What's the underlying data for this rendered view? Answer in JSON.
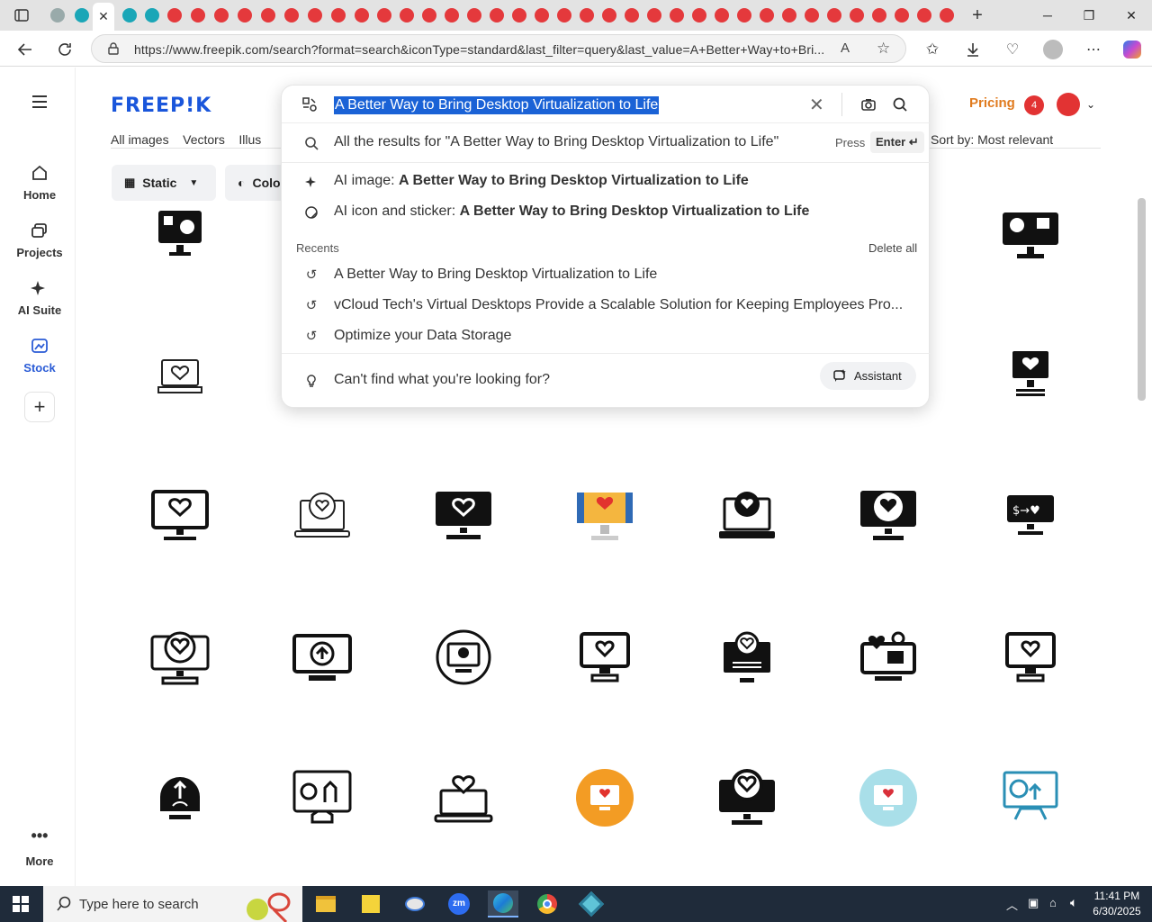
{
  "browser": {
    "url": "https://www.freepik.com/search?format=search&iconType=standard&last_filter=query&last_value=A+Better+Way+to+Bri...",
    "window_controls": [
      "minimize",
      "restore",
      "close"
    ]
  },
  "page": {
    "logo": "FREEP!K",
    "nav": {
      "items": [
        {
          "label": "Home",
          "icon": "home-icon"
        },
        {
          "label": "Projects",
          "icon": "projects-icon"
        },
        {
          "label": "AI Suite",
          "icon": "ai-suite-icon"
        },
        {
          "label": "Stock",
          "icon": "stock-icon"
        },
        {
          "label": "More",
          "icon": "more-icon"
        }
      ]
    },
    "header": {
      "pricing": "Pricing",
      "notifications_count": "4"
    },
    "filters": {
      "tabs_partial": "All images    Vectors    Illus",
      "static_label": "Static",
      "color_label": "Colo",
      "sort": "Sort by:  Most relevant"
    }
  },
  "search": {
    "value": "A Better Way to Bring Desktop Virtualization to Life",
    "all_results": "All the results for \"A Better Way to Bring Desktop Virtualization to Life\"",
    "press": "Press",
    "enter": "Enter ↵",
    "ai_image_prefix": "AI image: ",
    "ai_image_query": "A Better Way to Bring Desktop Virtualization to Life",
    "ai_icon_prefix": "AI icon and sticker: ",
    "ai_icon_query": "A Better Way to Bring Desktop Virtualization to Life",
    "recents_label": "Recents",
    "delete_all": "Delete all",
    "recents": [
      "A Better Way to Bring Desktop Virtualization to Life",
      "vCloud Tech's Virtual Desktops Provide a Scalable Solution for Keeping Employees Pro...",
      "Optimize your Data Storage"
    ],
    "cant_find": "Can't find what you're looking for?",
    "assistant": "Assistant"
  },
  "taskbar": {
    "search_placeholder": "Type here to search",
    "time": "11:41 PM",
    "date": "6/30/2025"
  },
  "colors": {
    "brand": "#1a56db",
    "pricing": "#e07b1f",
    "selection": "#1a62d6"
  }
}
